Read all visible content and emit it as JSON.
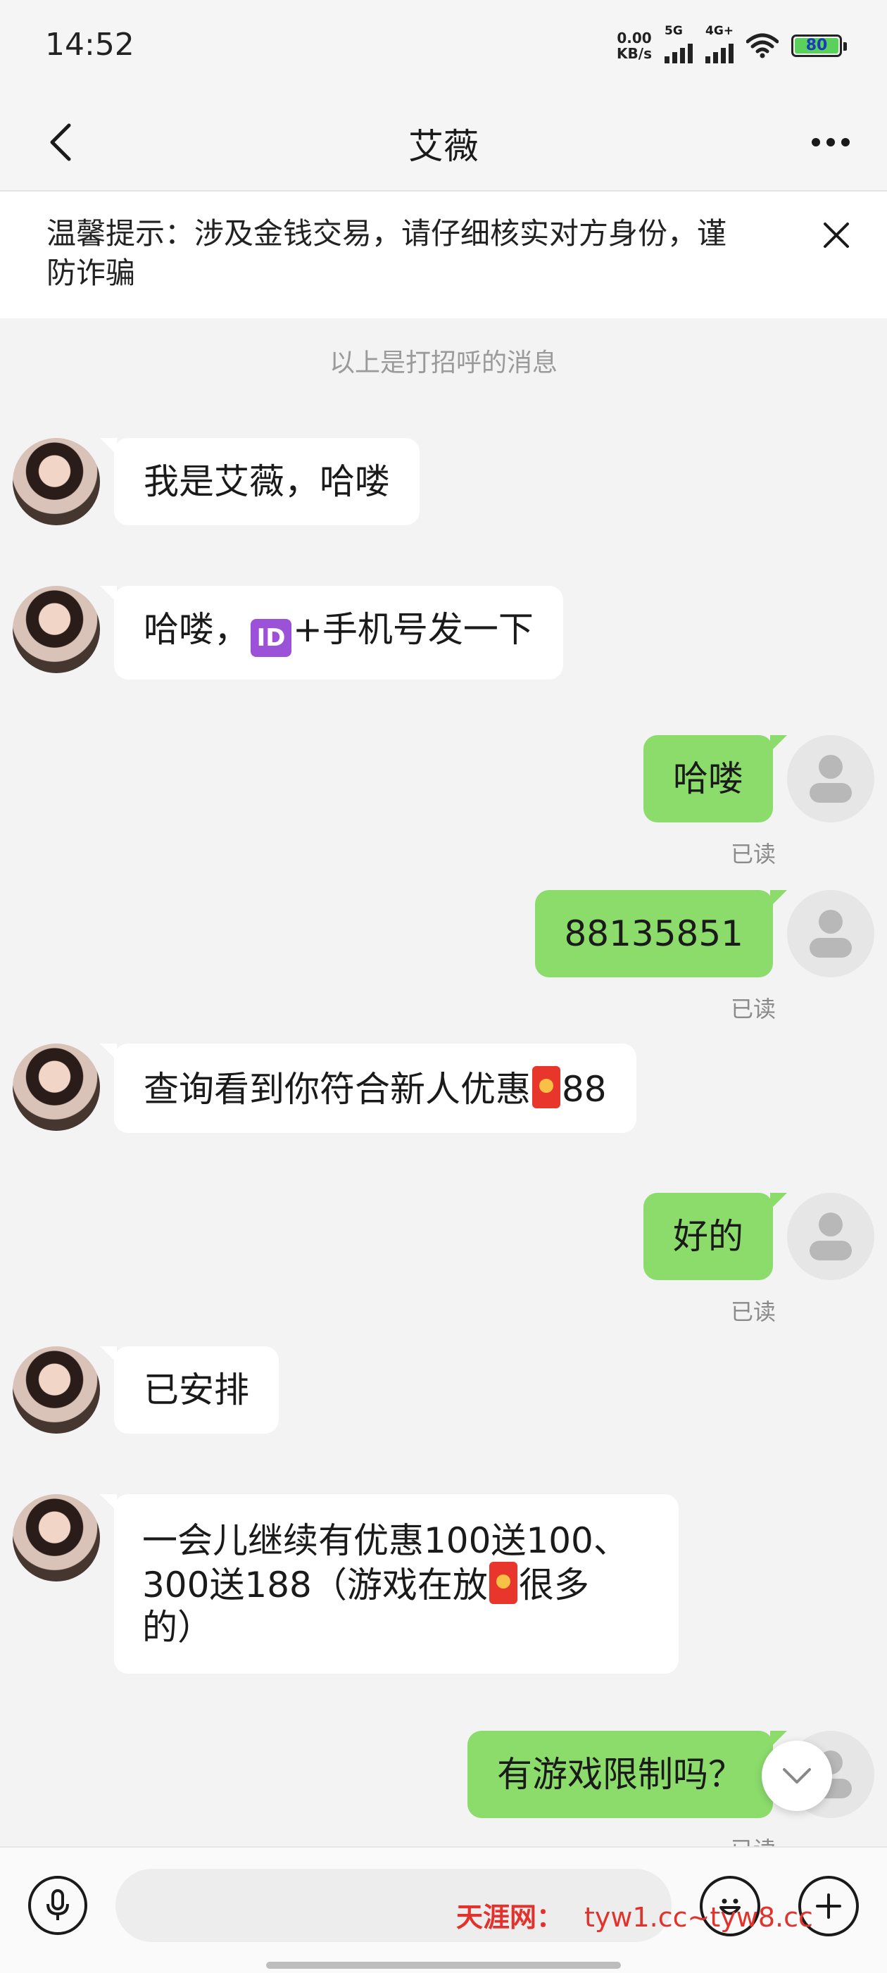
{
  "status_bar": {
    "time": "14:52",
    "net_speed_value": "0.00",
    "net_speed_unit": "KB/s",
    "signal_1": "5G",
    "signal_2": "4G+",
    "battery": "80"
  },
  "header": {
    "title": "艾薇",
    "back_icon": "chevron-left-icon",
    "more_icon": "more-dots-icon"
  },
  "notice": {
    "text": "温馨提示：涉及金钱交易，请仔细核实对方身份，谨防诈骗",
    "close_icon": "close-icon"
  },
  "system_tip": "以上是打招呼的消息",
  "messages": [
    {
      "side": "left",
      "text": "我是艾薇，哈喽"
    },
    {
      "side": "left",
      "text_before": "哈喽，",
      "emoji": "🆔",
      "text_after": "+手机号发一下"
    },
    {
      "side": "right",
      "text": "哈喽",
      "status": "已读"
    },
    {
      "side": "right",
      "text": "88135851",
      "status": "已读"
    },
    {
      "side": "left",
      "text_before": "查询看到你符合新人优惠",
      "emoji": "red-envelope-icon",
      "text_after": "88"
    },
    {
      "side": "right",
      "text": "好的",
      "status": "已读"
    },
    {
      "side": "left",
      "text": "已安排"
    },
    {
      "side": "left",
      "line1": "一会儿继续有优惠100送100、",
      "line2_before": "300送188（游戏在放",
      "emoji": "red-envelope-icon",
      "line2_after": "很多",
      "line3": "的）"
    },
    {
      "side": "right",
      "text": "有游戏限制吗？",
      "status": "已读"
    }
  ],
  "input_bar": {
    "placeholder": "",
    "voice_icon": "microphone-icon",
    "emoji_icon": "smiley-icon",
    "plus_icon": "plus-icon"
  },
  "watermark": {
    "brand": "天涯网：",
    "text": "tyw1.cc~tyw8.cc"
  },
  "colors": {
    "outgoing_bubble": "#8cdc6c",
    "incoming_bubble": "#ffffff",
    "background": "#f3f3f3",
    "watermark": "#e3312b"
  }
}
